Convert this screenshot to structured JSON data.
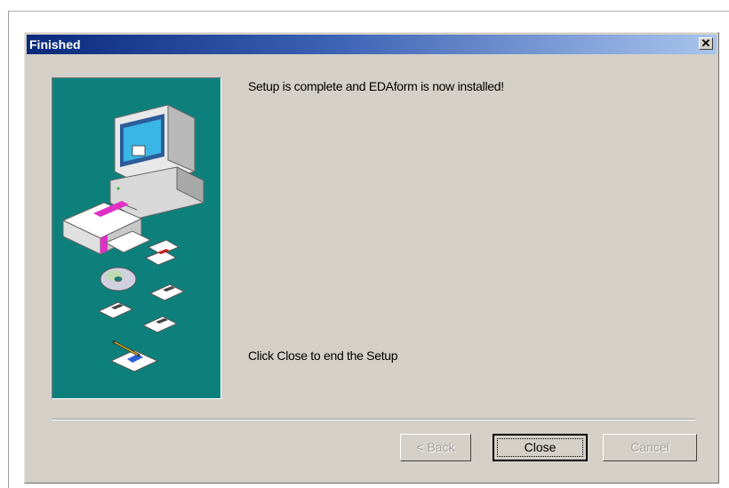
{
  "window": {
    "title": "Finished",
    "close_glyph": "✕"
  },
  "content": {
    "message_top": "Setup is complete and EDAform is now installed!",
    "message_bottom": "Click Close to end the Setup"
  },
  "buttons": {
    "back_label": "< Back",
    "close_label": "Close",
    "cancel_label": "Cancel"
  },
  "icons": {
    "art": "setup-wizard-illustration",
    "computer": "computer-icon",
    "box": "software-box-icon",
    "cd": "cd-icon",
    "floppy": "floppy-disk-icon",
    "pen": "pen-icon"
  },
  "colors": {
    "titlebar_start": "#0a2a7a",
    "titlebar_end": "#a8c4ec",
    "dialog_bg": "#d4d0c8",
    "art_bg": "#0e807c"
  }
}
